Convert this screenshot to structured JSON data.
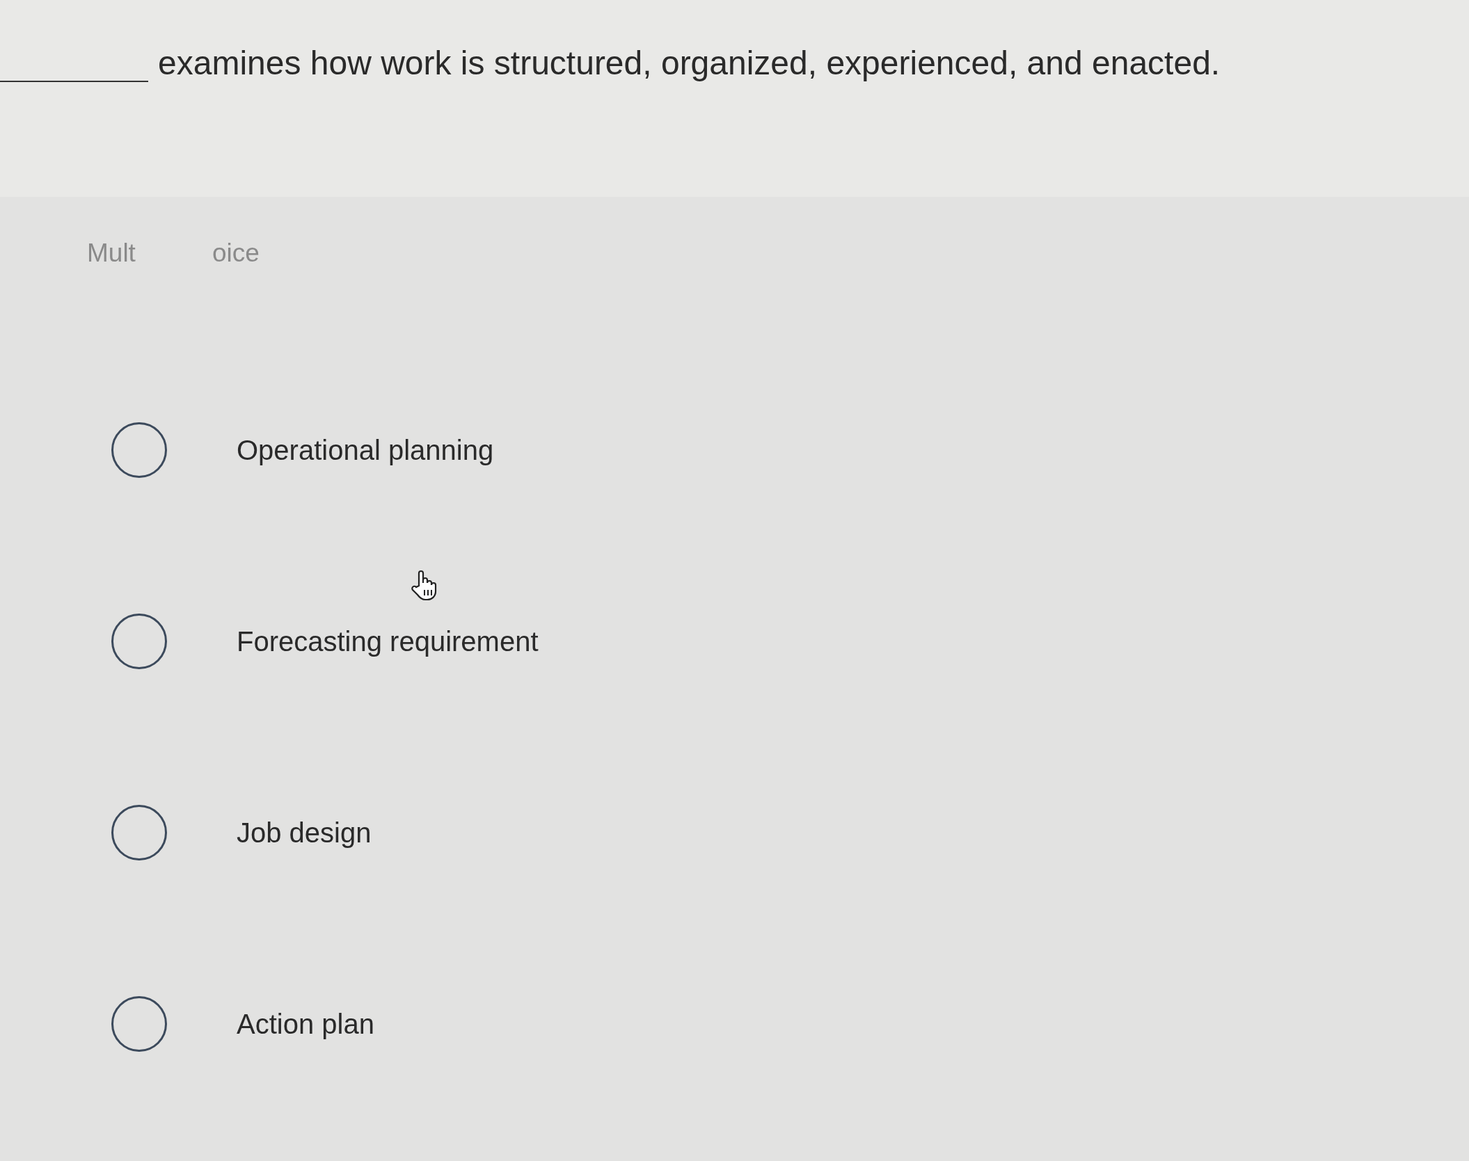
{
  "question": {
    "text": "examines how work is structured, organized, experienced, and enacted."
  },
  "question_type": {
    "parts": [
      "Mult",
      "oice"
    ]
  },
  "options": [
    {
      "label": "Operational planning",
      "selected": false
    },
    {
      "label": "Forecasting requirement",
      "selected": false
    },
    {
      "label": "Job design",
      "selected": false
    },
    {
      "label": "Action plan",
      "selected": false
    }
  ]
}
